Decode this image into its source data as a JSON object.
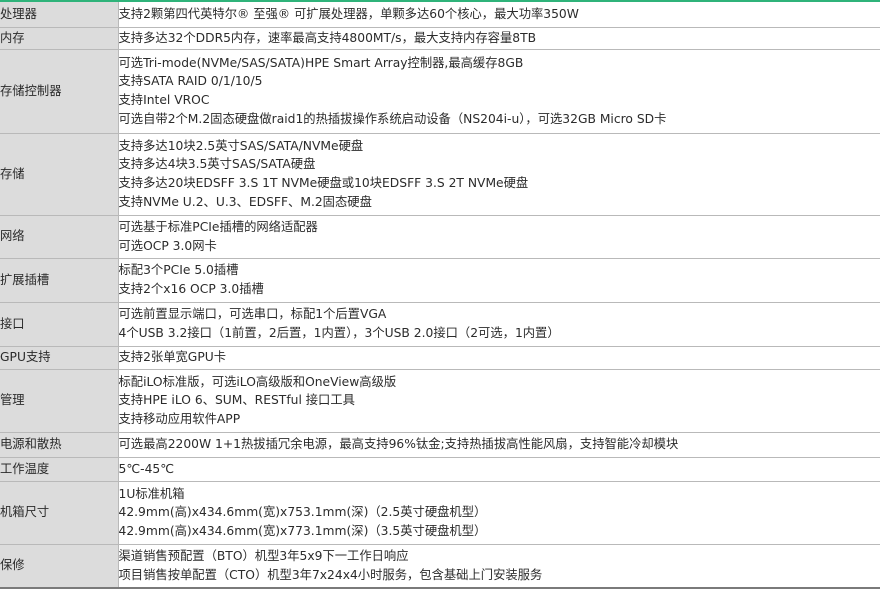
{
  "rows": [
    {
      "label": "处理器",
      "lines": [
        "支持2颗第四代英特尔® 至强® 可扩展处理器，单颗多达60个核心，最大功率350W"
      ]
    },
    {
      "label": "内存",
      "lines": [
        "支持多达32个DDR5内存，速率最高支持4800MT/s，最大支持内存容量8TB"
      ]
    },
    {
      "label": "存储控制器",
      "lines": [
        "可选Tri-mode(NVMe/SAS/SATA)HPE Smart Array控制器,最高缓存8GB",
        "支持SATA RAID 0/1/10/5",
        "支持Intel VROC",
        "可选自带2个M.2固态硬盘做raid1的热插拔操作系统启动设备（NS204i-u），可选32GB Micro SD卡"
      ]
    },
    {
      "label": "存储",
      "lines": [
        "支持多达10块2.5英寸SAS/SATA/NVMe硬盘",
        "支持多达4块3.5英寸SAS/SATA硬盘",
        "支持多达20块EDSFF 3.S 1T NVMe硬盘或10块EDSFF 3.S 2T NVMe硬盘",
        "支持NVMe U.2、U.3、EDSFF、M.2固态硬盘"
      ]
    },
    {
      "label": "网络",
      "lines": [
        "可选基于标准PCIe插槽的网络适配器",
        "可选OCP 3.0网卡"
      ]
    },
    {
      "label": "扩展插槽",
      "lines": [
        "标配3个PCIe 5.0插槽",
        "支持2个x16 OCP 3.0插槽"
      ]
    },
    {
      "label": "接口",
      "lines": [
        "可选前置显示端口，可选串口，标配1个后置VGA",
        "4个USB 3.2接口（1前置，2后置，1内置），3个USB 2.0接口（2可选，1内置）"
      ]
    },
    {
      "label": "GPU支持",
      "lines": [
        "支持2张单宽GPU卡"
      ]
    },
    {
      "label": "管理",
      "lines": [
        "标配iLO标准版，可选iLO高级版和OneView高级版",
        "支持HPE iLO 6、SUM、RESTful 接口工具",
        "支持移动应用软件APP"
      ]
    },
    {
      "label": "电源和散热",
      "lines": [
        "可选最高2200W 1+1热拔插冗余电源，最高支持96%钛金;支持热插拔高性能风扇，支持智能冷却模块"
      ]
    },
    {
      "label": "工作温度",
      "lines": [
        "5℃-45℃"
      ]
    },
    {
      "label": "机箱尺寸",
      "lines": [
        "1U标准机箱",
        "42.9mm(高)x434.6mm(宽)x753.1mm(深)（2.5英寸硬盘机型）",
        "42.9mm(高)x434.6mm(宽)x773.1mm(深)（3.5英寸硬盘机型）"
      ]
    },
    {
      "label": "保修",
      "lines": [
        "渠道销售预配置（BTO）机型3年5x9下一工作日响应",
        "项目销售按单配置（CTO）机型3年7x24x4小时服务，包含基础上门安装服务"
      ]
    }
  ]
}
